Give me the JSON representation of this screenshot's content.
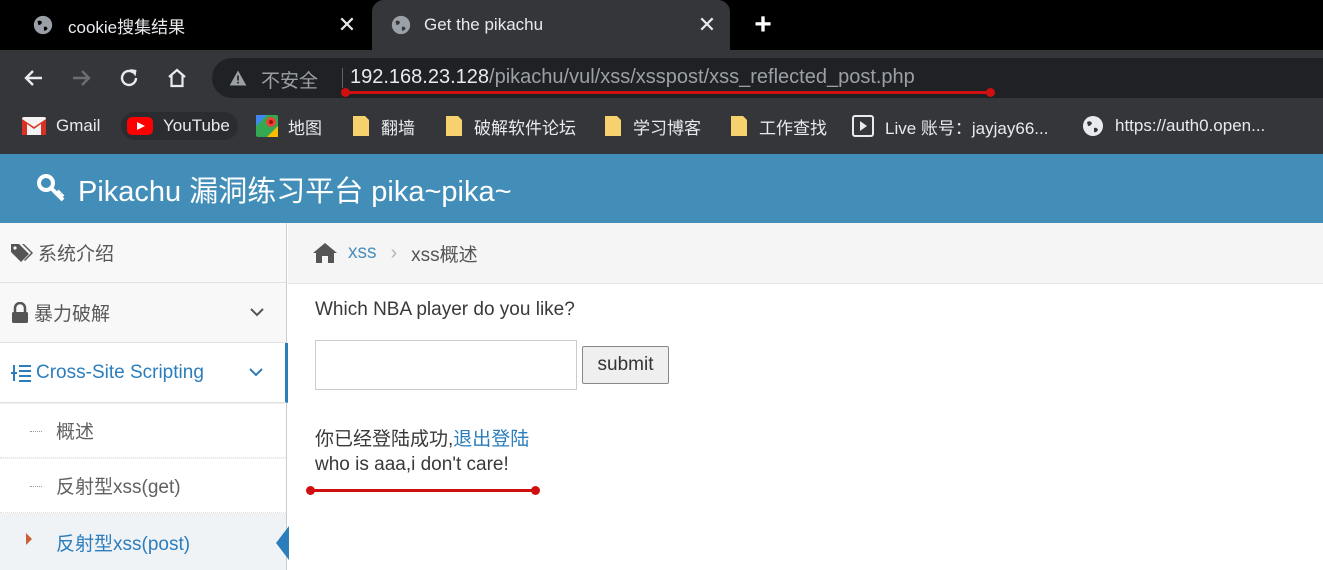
{
  "browser": {
    "tabs": [
      {
        "title": "cookie搜集结果",
        "active": false
      },
      {
        "title": "Get the pikachu",
        "active": true
      }
    ],
    "address": {
      "security_label": "不安全",
      "url_host": "192.168.23.128",
      "url_path": "/pikachu/vul/xss/xsspost/xss_reflected_post.php"
    },
    "bookmarks": [
      {
        "label": "Gmail",
        "icon": "gmail-icon"
      },
      {
        "label": "YouTube",
        "icon": "youtube-icon"
      },
      {
        "label": "地图",
        "icon": "maps-icon"
      },
      {
        "label": "翻墙",
        "icon": "folder-icon"
      },
      {
        "label": "破解软件论坛",
        "icon": "folder-icon"
      },
      {
        "label": "学习博客",
        "icon": "folder-icon"
      },
      {
        "label": "工作查找",
        "icon": "folder-icon"
      },
      {
        "label": "Live 账号：jayjay66...",
        "icon": "live-icon"
      },
      {
        "label": "https://auth0.open...",
        "icon": "globe-icon"
      }
    ]
  },
  "site": {
    "title": "Pikachu 漏洞练习平台 pika~pika~"
  },
  "sidebar": {
    "items": [
      {
        "label": "系统介绍",
        "icon": "tags-icon"
      },
      {
        "label": "暴力破解",
        "icon": "lock-icon"
      },
      {
        "label": "Cross-Site Scripting",
        "icon": "list-icon"
      }
    ],
    "subitems": [
      {
        "label": "概述"
      },
      {
        "label": "反射型xss(get)"
      },
      {
        "label": "反射型xss(post)"
      }
    ]
  },
  "breadcrumb": {
    "root": "xss",
    "separator": "›",
    "current": "xss概述"
  },
  "form": {
    "question": "Which NBA player do you like?",
    "input_value": "",
    "submit_label": "submit"
  },
  "messages": {
    "login_text": "你已经登陆成功,",
    "logout_link": "退出登陆",
    "result": "who is aaa,i don't care!"
  },
  "colors": {
    "header_blue": "#438eb9",
    "link_blue": "#2b7dbc",
    "annotation_red": "#d01010"
  }
}
